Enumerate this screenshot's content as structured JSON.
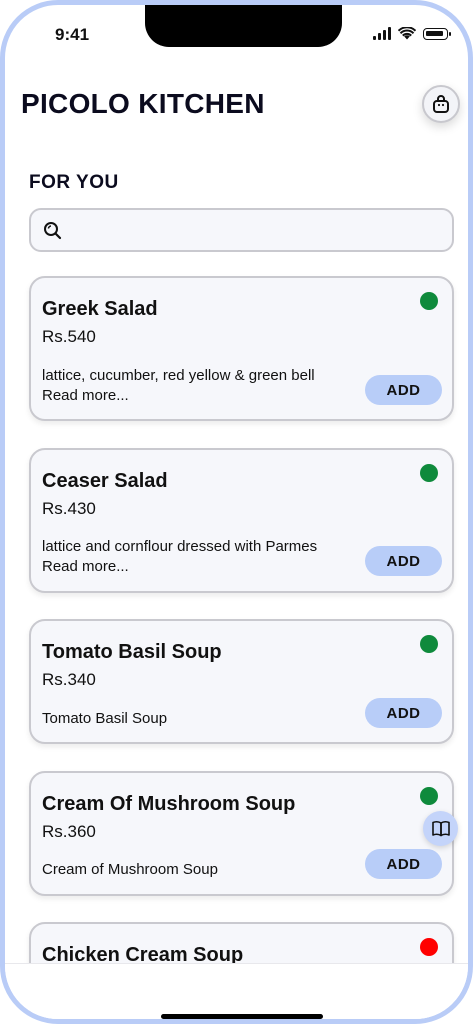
{
  "status_bar": {
    "time": "9:41"
  },
  "app": {
    "title": "PICOLO KITCHEN"
  },
  "section": {
    "title": "FOR YOU"
  },
  "search": {
    "placeholder": "",
    "value": ""
  },
  "colors": {
    "veg": "#0f8a3c",
    "nonveg": "#ff0000",
    "accent": "#b8cdf8",
    "frame": "#b9ccf7"
  },
  "items": [
    {
      "name": "Greek Salad",
      "price": "Rs.540",
      "description": "lattice, cucumber, red yellow & green bell",
      "read_more": "Read more...",
      "add_label": "ADD",
      "type": "veg"
    },
    {
      "name": "Ceaser Salad",
      "price": "Rs.430",
      "description": "lattice and cornflour dressed with Parmes",
      "read_more": "Read more...",
      "add_label": "ADD",
      "type": "veg"
    },
    {
      "name": "Tomato Basil Soup",
      "price": "Rs.340",
      "description": "Tomato Basil Soup",
      "read_more": "",
      "add_label": "ADD",
      "type": "veg"
    },
    {
      "name": "Cream Of Mushroom Soup",
      "price": "Rs.360",
      "description": "Cream of Mushroom Soup",
      "read_more": "",
      "add_label": "ADD",
      "type": "veg"
    },
    {
      "name": "Chicken Cream Soup",
      "price": "",
      "description": "",
      "read_more": "",
      "add_label": "",
      "type": "nonveg"
    }
  ],
  "icons": {
    "cart": "shopping-bag-icon",
    "search": "search-icon",
    "menu": "book-icon"
  }
}
